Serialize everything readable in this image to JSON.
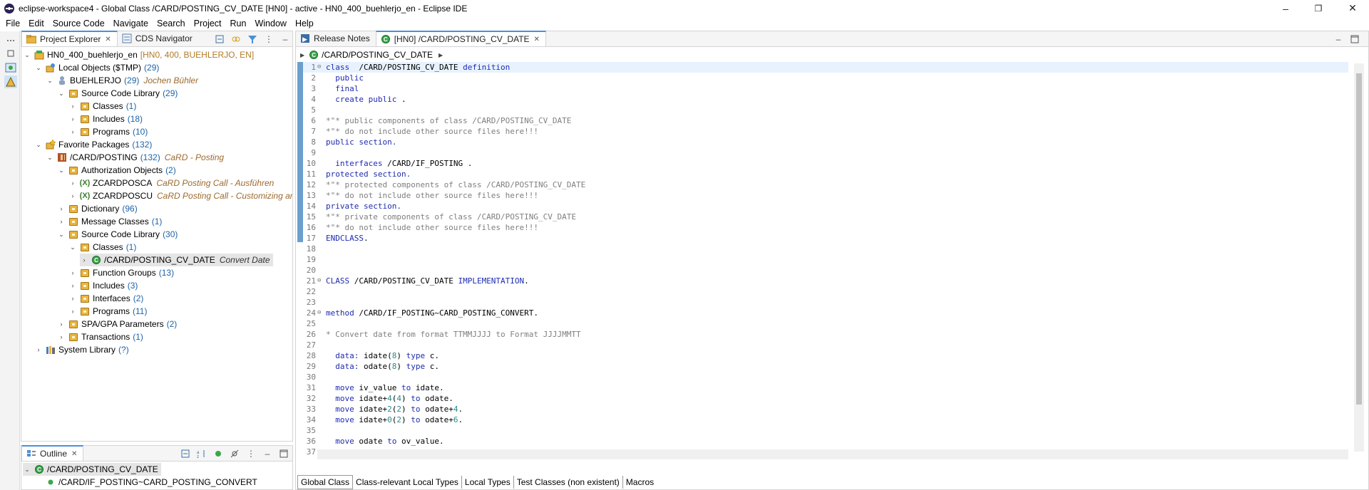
{
  "window": {
    "title": "eclipse-workspace4 - Global Class /CARD/POSTING_CV_DATE [HN0]  - active - HN0_400_buehlerjo_en - Eclipse IDE",
    "minimize": "–",
    "maximize": "❐",
    "close": "✕"
  },
  "menu": [
    "File",
    "Edit",
    "Source Code",
    "Navigate",
    "Search",
    "Project",
    "Run",
    "Window",
    "Help"
  ],
  "explorer": {
    "tabs": [
      {
        "label": "Project Explorer",
        "active": true
      },
      {
        "label": "CDS Navigator",
        "active": false
      }
    ],
    "tree": [
      {
        "label": "HN0_400_buehlerjo_en",
        "meta": "[HN0, 400, BUEHLERJO, EN]"
      },
      {
        "label": "Local Objects ($TMP)",
        "count": "(29)"
      },
      {
        "label": "BUEHLERJO",
        "count": "(29)",
        "desc": "Jochen Bühler"
      },
      {
        "label": "Source Code Library",
        "count": "(29)"
      },
      {
        "label": "Classes",
        "count": "(1)"
      },
      {
        "label": "Includes",
        "count": "(18)"
      },
      {
        "label": "Programs",
        "count": "(10)"
      },
      {
        "label": "Favorite Packages",
        "count": "(132)"
      },
      {
        "label": "/CARD/POSTING",
        "count": "(132)",
        "desc": "CaRD - Posting"
      },
      {
        "label": "Authorization Objects",
        "count": "(2)"
      },
      {
        "label": "ZCARDPOSCA",
        "desc": "CaRD Posting Call - Ausführen"
      },
      {
        "label": "ZCARDPOSCU",
        "desc": "CaRD Posting Call - Customizing anzeigen / pflegen"
      },
      {
        "label": "Dictionary",
        "count": "(96)"
      },
      {
        "label": "Message Classes",
        "count": "(1)"
      },
      {
        "label": "Source Code Library",
        "count": "(30)"
      },
      {
        "label": "Classes",
        "count": "(1)"
      },
      {
        "label": "/CARD/POSTING_CV_DATE",
        "desc": "Convert Date"
      },
      {
        "label": "Function Groups",
        "count": "(13)"
      },
      {
        "label": "Includes",
        "count": "(3)"
      },
      {
        "label": "Interfaces",
        "count": "(2)"
      },
      {
        "label": "Programs",
        "count": "(11)"
      },
      {
        "label": "SPA/GPA Parameters",
        "count": "(2)"
      },
      {
        "label": "Transactions",
        "count": "(1)"
      },
      {
        "label": "System Library",
        "count": "(?)"
      }
    ]
  },
  "outline": {
    "tab": "Outline",
    "items": [
      "/CARD/POSTING_CV_DATE",
      "/CARD/IF_POSTING~CARD_POSTING_CONVERT"
    ]
  },
  "editor": {
    "tabs": [
      {
        "label": "Release Notes",
        "active": false
      },
      {
        "label": "[HN0] /CARD/POSTING_CV_DATE",
        "active": true
      }
    ],
    "breadcrumb": "/CARD/POSTING_CV_DATE",
    "bottom_tabs": [
      "Global Class",
      "Class-relevant Local Types",
      "Local Types",
      "Test Classes (non existent)",
      "Macros"
    ],
    "lines": [
      {
        "n": "1",
        "fold": "⊖",
        "parts": [
          [
            "kw",
            "class"
          ],
          [
            "",
            "  /CARD/POSTING_CV_DATE "
          ],
          [
            "kw",
            "definition"
          ]
        ]
      },
      {
        "n": "2",
        "parts": [
          [
            "kw",
            "  public"
          ]
        ]
      },
      {
        "n": "3",
        "parts": [
          [
            "kw",
            "  final"
          ]
        ]
      },
      {
        "n": "4",
        "parts": [
          [
            "kw",
            "  create public"
          ],
          [
            "",
            " ."
          ]
        ]
      },
      {
        "n": "5",
        "parts": []
      },
      {
        "n": "6",
        "parts": [
          [
            "cm",
            "*\"* public components of class /CARD/POSTING_CV_DATE"
          ]
        ]
      },
      {
        "n": "7",
        "parts": [
          [
            "cm",
            "*\"* do not include other source files here!!!"
          ]
        ]
      },
      {
        "n": "8",
        "parts": [
          [
            "kw",
            "public section."
          ]
        ]
      },
      {
        "n": "9",
        "parts": []
      },
      {
        "n": "10",
        "parts": [
          [
            "kw",
            "  interfaces"
          ],
          [
            "",
            " /CARD/IF_POSTING ."
          ]
        ]
      },
      {
        "n": "11",
        "parts": [
          [
            "kw",
            "protected section."
          ]
        ]
      },
      {
        "n": "12",
        "parts": [
          [
            "cm",
            "*\"* protected components of class /CARD/POSTING_CV_DATE"
          ]
        ]
      },
      {
        "n": "13",
        "parts": [
          [
            "cm",
            "*\"* do not include other source files here!!!"
          ]
        ]
      },
      {
        "n": "14",
        "parts": [
          [
            "kw",
            "private section."
          ]
        ]
      },
      {
        "n": "15",
        "parts": [
          [
            "cm",
            "*\"* private components of class /CARD/POSTING_CV_DATE"
          ]
        ]
      },
      {
        "n": "16",
        "parts": [
          [
            "cm",
            "*\"* do not include other source files here!!!"
          ]
        ]
      },
      {
        "n": "17",
        "parts": [
          [
            "kw",
            "ENDCLASS"
          ],
          [
            "",
            "."
          ]
        ]
      },
      {
        "n": "18",
        "parts": []
      },
      {
        "n": "19",
        "parts": []
      },
      {
        "n": "20",
        "parts": []
      },
      {
        "n": "21",
        "fold": "⊖",
        "parts": [
          [
            "kw",
            "CLASS"
          ],
          [
            "",
            " /CARD/POSTING_CV_DATE "
          ],
          [
            "kw",
            "IMPLEMENTATION"
          ],
          [
            "",
            "."
          ]
        ]
      },
      {
        "n": "22",
        "parts": []
      },
      {
        "n": "23",
        "parts": []
      },
      {
        "n": "24",
        "fold": "⊖",
        "parts": [
          [
            "kw",
            "method"
          ],
          [
            "",
            " /CARD/IF_POSTING~CARD_POSTING_CONVERT."
          ]
        ]
      },
      {
        "n": "25",
        "parts": []
      },
      {
        "n": "26",
        "parts": [
          [
            "cm",
            "* Convert date from format TTMMJJJJ to Format JJJJMMTT"
          ]
        ]
      },
      {
        "n": "27",
        "parts": []
      },
      {
        "n": "28",
        "parts": [
          [
            "kw",
            "  data:"
          ],
          [
            "",
            " idate("
          ],
          [
            "nm",
            "8"
          ],
          [
            "",
            ") "
          ],
          [
            "kw",
            "type"
          ],
          [
            "",
            " c."
          ]
        ]
      },
      {
        "n": "29",
        "parts": [
          [
            "kw",
            "  data:"
          ],
          [
            "",
            " odate("
          ],
          [
            "nm",
            "8"
          ],
          [
            "",
            ") "
          ],
          [
            "kw",
            "type"
          ],
          [
            "",
            " c."
          ]
        ]
      },
      {
        "n": "30",
        "parts": []
      },
      {
        "n": "31",
        "parts": [
          [
            "kw",
            "  move"
          ],
          [
            "",
            " iv_value "
          ],
          [
            "kw",
            "to"
          ],
          [
            "",
            " idate."
          ]
        ]
      },
      {
        "n": "32",
        "parts": [
          [
            "kw",
            "  move"
          ],
          [
            "",
            " idate+"
          ],
          [
            "nm",
            "4"
          ],
          [
            "",
            "("
          ],
          [
            "nm",
            "4"
          ],
          [
            "",
            ") "
          ],
          [
            "kw",
            "to"
          ],
          [
            "",
            " odate."
          ]
        ]
      },
      {
        "n": "33",
        "parts": [
          [
            "kw",
            "  move"
          ],
          [
            "",
            " idate+"
          ],
          [
            "nm",
            "2"
          ],
          [
            "",
            "("
          ],
          [
            "nm",
            "2"
          ],
          [
            "",
            ") "
          ],
          [
            "kw",
            "to"
          ],
          [
            "",
            " odate+"
          ],
          [
            "nm",
            "4"
          ],
          [
            "",
            "."
          ]
        ]
      },
      {
        "n": "34",
        "parts": [
          [
            "kw",
            "  move"
          ],
          [
            "",
            " idate+"
          ],
          [
            "nm",
            "0"
          ],
          [
            "",
            "("
          ],
          [
            "nm",
            "2"
          ],
          [
            "",
            ") "
          ],
          [
            "kw",
            "to"
          ],
          [
            "",
            " odate+"
          ],
          [
            "nm",
            "6"
          ],
          [
            "",
            "."
          ]
        ]
      },
      {
        "n": "35",
        "parts": []
      },
      {
        "n": "36",
        "parts": [
          [
            "kw",
            "  move"
          ],
          [
            "",
            " odate "
          ],
          [
            "kw",
            "to"
          ],
          [
            "",
            " ov_value."
          ]
        ]
      },
      {
        "n": "37",
        "parts": []
      }
    ]
  }
}
